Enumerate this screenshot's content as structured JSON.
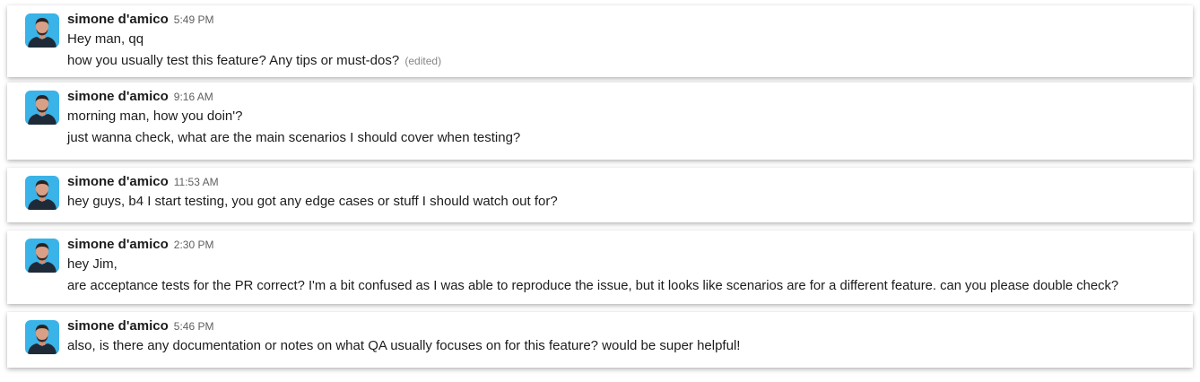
{
  "messages": [
    {
      "sender": "simone d'amico",
      "time": "5:49 PM",
      "lines": [
        "Hey man, qq",
        "how you usually test this feature? Any tips or must-dos?"
      ],
      "edited": "(edited)"
    },
    {
      "sender": "simone d'amico",
      "time": "9:16 AM",
      "lines": [
        "morning man, how you doin'?",
        "just wanna check, what are the main scenarios I should cover when testing?"
      ]
    },
    {
      "sender": "simone d'amico",
      "time": "11:53 AM",
      "lines": [
        "hey guys, b4 I start testing, you got any edge cases or stuff I should watch out for?"
      ]
    },
    {
      "sender": "simone d'amico",
      "time": "2:30 PM",
      "lines": [
        "hey Jim,",
        "are acceptance tests for the PR correct? I'm a bit confused as I was able to reproduce the issue, but it looks like scenarios are for a different feature. can you please double check?"
      ]
    },
    {
      "sender": "simone d'amico",
      "time": "5:46 PM",
      "lines": [
        "also, is there any documentation or notes on what QA usually focuses on for this feature? would be super helpful!"
      ]
    }
  ],
  "avatar_icon": "user-avatar-icon",
  "colors": {
    "avatar_bg": "#3ab3e8",
    "text": "#1d1c1d",
    "timestamp": "#616061"
  }
}
